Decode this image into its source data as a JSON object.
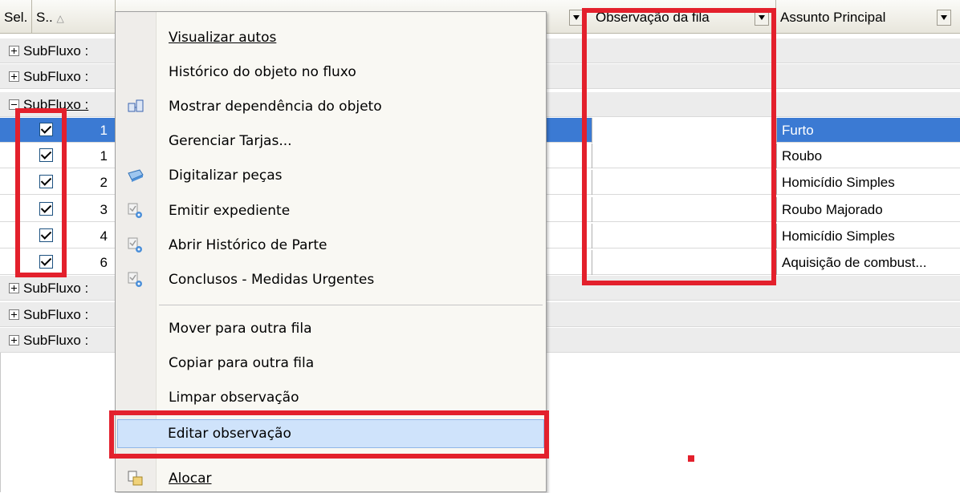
{
  "header": {
    "col_sel": "Sel.",
    "col_s": "S..",
    "col_observacao": "Observação da fila",
    "col_assunto": "Assunto Principal",
    "sort_icon": "sort-ascending-icon"
  },
  "groups": [
    {
      "label": "SubFluxo :",
      "expanded": false
    },
    {
      "label": "SubFluxo :",
      "expanded": false
    },
    {
      "label": "SubFluxo :",
      "expanded": true
    },
    {
      "label": "SubFluxo :",
      "expanded": false
    },
    {
      "label": "SubFluxo :",
      "expanded": false
    },
    {
      "label": "SubFluxo :",
      "expanded": false
    }
  ],
  "rows": [
    {
      "seq": "1",
      "checked": true,
      "observacao": "",
      "assunto": "Furto",
      "selected": true
    },
    {
      "seq": "1",
      "checked": true,
      "observacao": "",
      "assunto": "Roubo",
      "selected": false
    },
    {
      "seq": "2",
      "checked": true,
      "observacao": "",
      "assunto": "Homicídio Simples",
      "selected": false
    },
    {
      "seq": "3",
      "checked": true,
      "observacao": "",
      "assunto": "Roubo Majorado",
      "selected": false
    },
    {
      "seq": "4",
      "checked": true,
      "observacao": "",
      "assunto": "Homicídio Simples",
      "selected": false
    },
    {
      "seq": "6",
      "checked": true,
      "observacao": "",
      "assunto": "Aquisição de combust...",
      "selected": false
    }
  ],
  "context_menu": {
    "items": [
      {
        "label": "Visualizar autos",
        "icon": ""
      },
      {
        "label": "Histórico do objeto no fluxo",
        "icon": ""
      },
      {
        "label": "Mostrar dependência do objeto",
        "icon": "dependency-icon"
      },
      {
        "label": "Gerenciar Tarjas...",
        "icon": ""
      },
      {
        "label": "Digitalizar peças",
        "icon": "scanner-icon"
      },
      {
        "label": "Emitir expediente",
        "icon": "document-gear-icon"
      },
      {
        "label": "Abrir Histórico de Parte",
        "icon": "document-gear-icon"
      },
      {
        "label": "Conclusos - Medidas Urgentes",
        "icon": "document-gear-icon"
      },
      {
        "label": "Mover para outra fila",
        "icon": ""
      },
      {
        "label": "Copiar para outra fila",
        "icon": ""
      },
      {
        "label": "Limpar observação",
        "icon": ""
      },
      {
        "label": "Editar observação",
        "icon": "",
        "highlighted": true
      },
      {
        "label": "Alocar",
        "icon": "allocate-icon"
      }
    ]
  },
  "colors": {
    "selection_blue": "#3b7ad3",
    "menu_highlight": "#cfe3fb",
    "annotation_red": "#e3202c"
  }
}
